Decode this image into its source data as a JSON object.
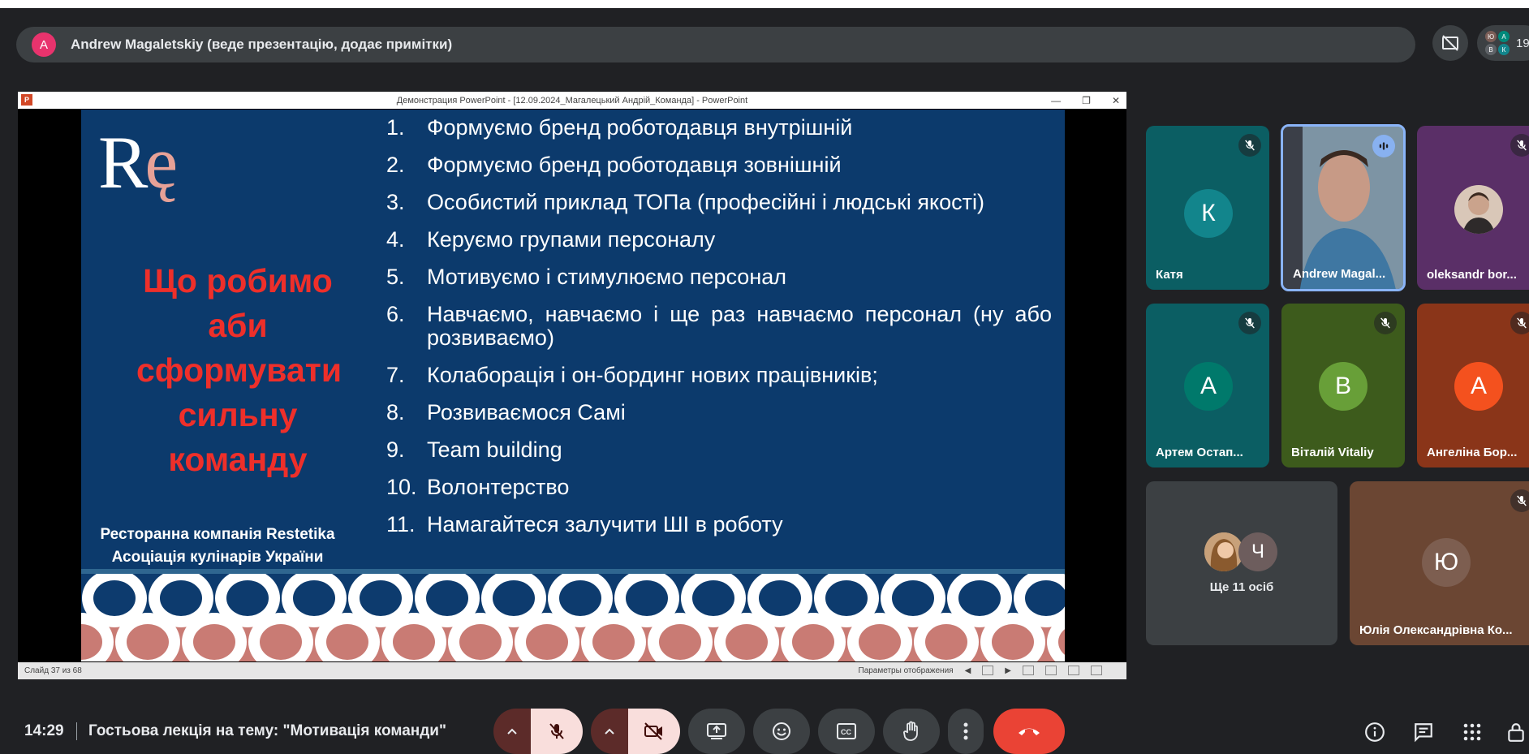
{
  "presenter_bar": {
    "avatar_letter": "A",
    "text": "Andrew Magaletskiy (веде презентацію, додає примітки)"
  },
  "people_count": {
    "count": "19",
    "mini_avatars": [
      "Ю",
      "А",
      "К",
      "В"
    ]
  },
  "powerpoint": {
    "window_title": "Демонстрация PowerPoint - [12.09.2024_Магалецький Андрій_Команда] - PowerPoint",
    "status_left": "Слайд 37 из 68",
    "status_view": "Параметры отображения"
  },
  "slide": {
    "logo_r": "R",
    "logo_e": "ę",
    "heading_lines": [
      "Що робимо",
      "аби",
      "сформувати",
      "сильну",
      "команду"
    ],
    "footer_lines": [
      "Ресторанна компанія Restetika",
      "Асоціація кулінарів України"
    ],
    "items": [
      {
        "num": "1.",
        "text": "Формуємо бренд роботодавця внутрішній"
      },
      {
        "num": "2.",
        "text": "Формуємо бренд роботодавця зовнішній"
      },
      {
        "num": "3.",
        "text": "Особистий приклад ТОПа (професійні і людські якості)"
      },
      {
        "num": "4.",
        "text": "Керуємо групами персоналу"
      },
      {
        "num": "5.",
        "text": "Мотивуємо і стимулюємо персонал"
      },
      {
        "num": "6.",
        "text": "Навчаємо, навчаємо і ще раз навчаємо персонал (ну або розвиваємо)"
      },
      {
        "num": "7.",
        "text": "Колаборація і он-бординг нових працівників;"
      },
      {
        "num": "8.",
        "text": "Розвиваємося Самі"
      },
      {
        "num": "9.",
        "text": "Team building"
      },
      {
        "num": "10.",
        "text": "Волонтерство"
      },
      {
        "num": "11.",
        "text": "Намагайтеся залучити ШІ в роботу"
      }
    ]
  },
  "participants": {
    "katya": {
      "letter": "К",
      "name": "Катя"
    },
    "andrew": {
      "name": "Andrew Magal..."
    },
    "oleksandr": {
      "name": "oleksandr bor..."
    },
    "artem": {
      "letter": "А",
      "name": "Артем Остап..."
    },
    "vitaliy": {
      "letter": "В",
      "name": "Віталій Vitaliy"
    },
    "angelina": {
      "letter": "А",
      "name": "Ангеліна Бор..."
    },
    "more": {
      "letter": "Ч",
      "label": "Ще 11 осіб"
    },
    "yulia": {
      "letter": "Ю",
      "name": "Юлія Олександрівна Ко..."
    }
  },
  "bottom_bar": {
    "time": "14:29",
    "meeting_title": "Гостьова лекція на тему: \"Мотивація команди\""
  },
  "colors": {
    "background": "#202124",
    "slide_blue": "#0c3a6c",
    "heading_red": "#ee2f2a",
    "hangup_red": "#ea4335",
    "muted_control": "#f9dedc"
  },
  "icons": [
    "hide-tiles-icon",
    "mic-off-icon",
    "camera-off-icon",
    "present-screen-icon",
    "emoji-icon",
    "captions-icon",
    "raise-hand-icon",
    "more-options-icon",
    "hang-up-icon",
    "info-icon",
    "chat-icon",
    "apps-icon",
    "lock-icon",
    "speaking-icon"
  ]
}
